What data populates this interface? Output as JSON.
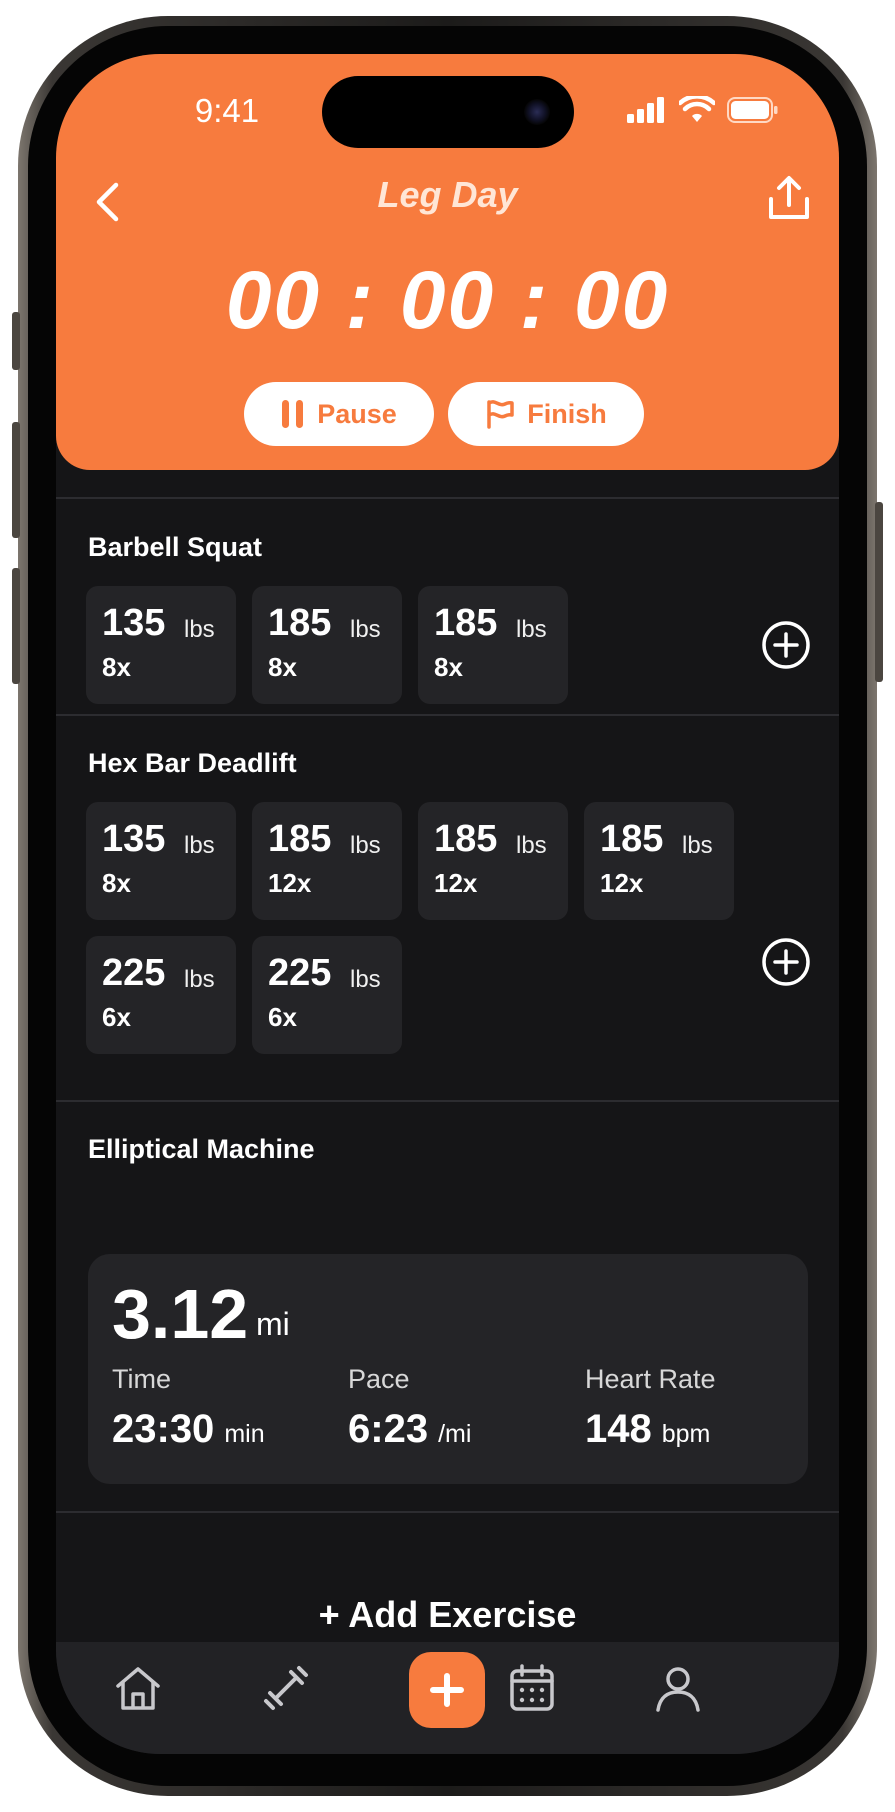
{
  "status_bar": {
    "time": "9:41"
  },
  "workout": {
    "title": "Leg Day",
    "timer": "00 : 00 : 00",
    "pause_label": "Pause",
    "finish_label": "Finish"
  },
  "exercises": [
    {
      "name": "Barbell Squat",
      "sets": [
        {
          "weight": "135",
          "unit": "lbs",
          "reps": "8x"
        },
        {
          "weight": "185",
          "unit": "lbs",
          "reps": "8x"
        },
        {
          "weight": "185",
          "unit": "lbs",
          "reps": "8x"
        }
      ]
    },
    {
      "name": "Hex Bar Deadlift",
      "sets": [
        {
          "weight": "135",
          "unit": "lbs",
          "reps": "8x"
        },
        {
          "weight": "185",
          "unit": "lbs",
          "reps": "12x"
        },
        {
          "weight": "185",
          "unit": "lbs",
          "reps": "12x"
        },
        {
          "weight": "185",
          "unit": "lbs",
          "reps": "12x"
        },
        {
          "weight": "225",
          "unit": "lbs",
          "reps": "6x"
        },
        {
          "weight": "225",
          "unit": "lbs",
          "reps": "6x"
        }
      ]
    }
  ],
  "cardio": {
    "name": "Elliptical Machine",
    "distance": "3.12",
    "distance_unit": "mi",
    "metrics": [
      {
        "label": "Time",
        "value": "23:30",
        "unit": "min"
      },
      {
        "label": "Pace",
        "value": "6:23",
        "unit": "/mi"
      },
      {
        "label": "Heart Rate",
        "value": "148",
        "unit": "bpm"
      }
    ]
  },
  "add_exercise_label": "+ Add Exercise",
  "tabbar": {
    "items": [
      "home-icon",
      "dumbbell-icon",
      "plus-icon",
      "calendar-icon",
      "profile-icon"
    ]
  },
  "colors": {
    "accent": "#f77b3e",
    "background": "#151517",
    "card": "#242427"
  }
}
